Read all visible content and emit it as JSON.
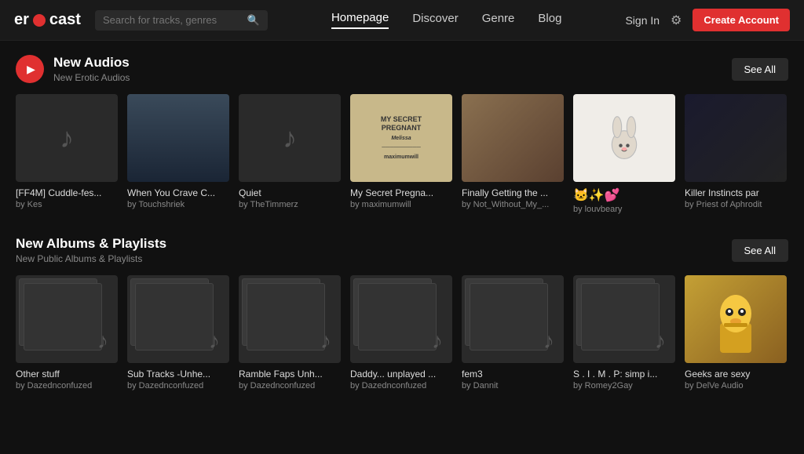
{
  "header": {
    "logo": "erocast",
    "search_placeholder": "Search for tracks, genres",
    "nav": [
      {
        "label": "Homepage",
        "active": true
      },
      {
        "label": "Discover",
        "active": false
      },
      {
        "label": "Genre",
        "active": false
      },
      {
        "label": "Blog",
        "active": false
      }
    ],
    "sign_in": "Sign In",
    "create_account": "Create Account"
  },
  "new_audios": {
    "title": "New Audios",
    "subtitle": "New Erotic Audios",
    "see_all": "See All",
    "items": [
      {
        "title": "[FF4M] Cuddle-fes...",
        "author": "by Kes",
        "has_image": false
      },
      {
        "title": "When You Crave C...",
        "author": "by Touchshriek",
        "has_image": false,
        "type": "suit"
      },
      {
        "title": "Quiet",
        "author": "by TheTimmerz",
        "has_image": false
      },
      {
        "title": "My Secret Pregna...",
        "author": "by maximumwill",
        "has_image": true,
        "type": "pregnant"
      },
      {
        "title": "Finally Getting the ...",
        "author": "by Not_Without_My_...",
        "has_image": true,
        "type": "cowgirl"
      },
      {
        "title": "🐱✨💕",
        "author": "by louvbeary",
        "has_image": true,
        "type": "bunny"
      },
      {
        "title": "Killer Instincts par",
        "author": "by Priest of Aphrodit",
        "has_image": true,
        "type": "gun"
      }
    ]
  },
  "new_albums": {
    "title": "New Albums & Playlists",
    "subtitle": "New Public Albums & Playlists",
    "see_all": "See All",
    "items": [
      {
        "title": "Other stuff",
        "author": "by Dazednconfuzed",
        "has_image": false
      },
      {
        "title": "Sub Tracks -Unhe...",
        "author": "by Dazednconfuzed",
        "has_image": false
      },
      {
        "title": "Ramble Faps Unh...",
        "author": "by Dazednconfuzed",
        "has_image": false
      },
      {
        "title": "Daddy... unplayed ...",
        "author": "by Dazednconfuzed",
        "has_image": false
      },
      {
        "title": "fem3",
        "author": "by Dannit",
        "has_image": false
      },
      {
        "title": "S . I . M . P: simp i...",
        "author": "by Romey2Gay",
        "has_image": false
      },
      {
        "title": "Geeks are sexy",
        "author": "by DelVe Audio",
        "has_image": true,
        "type": "geeks"
      }
    ]
  }
}
